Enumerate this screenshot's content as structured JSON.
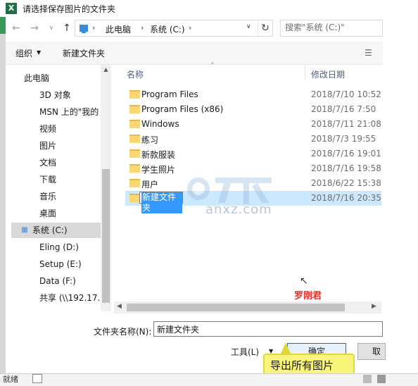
{
  "title": "请选择保存图片的文件夹",
  "address": {
    "crumbs": [
      "此电脑",
      "系统 (C:)"
    ],
    "search_placeholder": "搜索\"系统 (C:)\""
  },
  "toolbar": {
    "organize": "组织",
    "new_folder": "新建文件夹"
  },
  "nav": {
    "items": [
      {
        "label": "此电脑",
        "icon": "computer-icon"
      },
      {
        "label": "3D 对象",
        "icon": "cube-3d-icon"
      },
      {
        "label": "MSN 上的\"我的",
        "icon": "msn-icon"
      },
      {
        "label": "视频",
        "icon": "video-icon"
      },
      {
        "label": "图片",
        "icon": "picture-icon"
      },
      {
        "label": "文档",
        "icon": "document-icon"
      },
      {
        "label": "下载",
        "icon": "download-icon"
      },
      {
        "label": "音乐",
        "icon": "music-icon"
      },
      {
        "label": "桌面",
        "icon": "desktop-icon"
      },
      {
        "label": "系统 (C:)",
        "icon": "drive-c-icon"
      },
      {
        "label": "Eling (D:)",
        "icon": "drive-icon"
      },
      {
        "label": "Setup (E:)",
        "icon": "drive-icon"
      },
      {
        "label": "Data (F:)",
        "icon": "drive-icon"
      },
      {
        "label": "共享 (\\\\192.17.",
        "icon": "network-drive-icon"
      }
    ],
    "selected": "系统 (C:)"
  },
  "list": {
    "col_name": "名称",
    "col_date": "修改日期",
    "rows": [
      {
        "name": "Program Files",
        "date": "2018/7/10 10:52"
      },
      {
        "name": "Program Files (x86)",
        "date": "2018/7/16 7:50"
      },
      {
        "name": "Windows",
        "date": "2018/7/11 21:08"
      },
      {
        "name": "练习",
        "date": "2018/7/3 19:55"
      },
      {
        "name": "新款服装",
        "date": "2018/7/16 19:01"
      },
      {
        "name": "学生照片",
        "date": "2018/7/16 19:58"
      },
      {
        "name": "用户",
        "date": "2018/6/22 15:38"
      },
      {
        "name": "新建文件夹",
        "date": "2018/7/16 20:35"
      }
    ]
  },
  "watermark": {
    "text": "安下载",
    "sub": "anxz.com"
  },
  "annotation": {
    "author": "罗刚君",
    "callout": "导出所有图片"
  },
  "bottom": {
    "filename_label": "文件夹名称(N):",
    "filename_value": "新建文件夹",
    "tools": "工具(L)",
    "confirm": "确定",
    "cancel": "取"
  },
  "status": {
    "text": "就绪"
  },
  "colors": {
    "selection": "#cce8ff",
    "accent": "#0078d7",
    "callout_bg": "#f9f47a",
    "author_red": "#e0322c"
  }
}
